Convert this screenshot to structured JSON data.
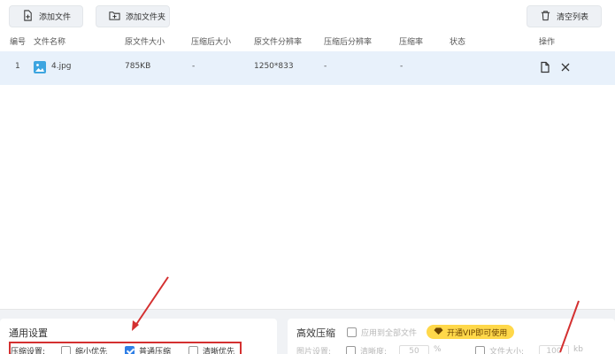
{
  "toolbar": {
    "add_file": "添加文件",
    "add_folder": "添加文件夹",
    "clear_list": "清空列表"
  },
  "table": {
    "headers": [
      "编号",
      "文件名称",
      "原文件大小",
      "压缩后大小",
      "原文件分辨率",
      "压缩后分辨率",
      "压缩率",
      "状态",
      "操作"
    ],
    "rows": [
      {
        "index": "1",
        "name": "4.jpg",
        "orig_size": "785KB",
        "comp_size": "-",
        "orig_res": "1250*833",
        "comp_res": "-",
        "ratio": "-",
        "status": ""
      }
    ]
  },
  "general": {
    "title": "通用设置",
    "label": "压缩设置:",
    "options": [
      {
        "label": "缩小优先",
        "checked": false
      },
      {
        "label": "普通压缩",
        "checked": true
      },
      {
        "label": "清晰优先",
        "checked": false
      }
    ]
  },
  "efficient": {
    "title": "高效压缩",
    "apply_all": "应用到全部文件",
    "vip": "开通VIP即可使用",
    "image_label": "图片设置:",
    "clarity_label": "清晰度:",
    "clarity_value": "50",
    "clarity_unit": "%",
    "filesize_label": "文件大小:",
    "filesize_value": "100",
    "filesize_unit": "kb"
  },
  "colors": {
    "accent": "#2f7fe6",
    "highlight_box": "#d43030",
    "vip_badge": "#ffd84a",
    "row_selected": "#e8f1fb"
  }
}
